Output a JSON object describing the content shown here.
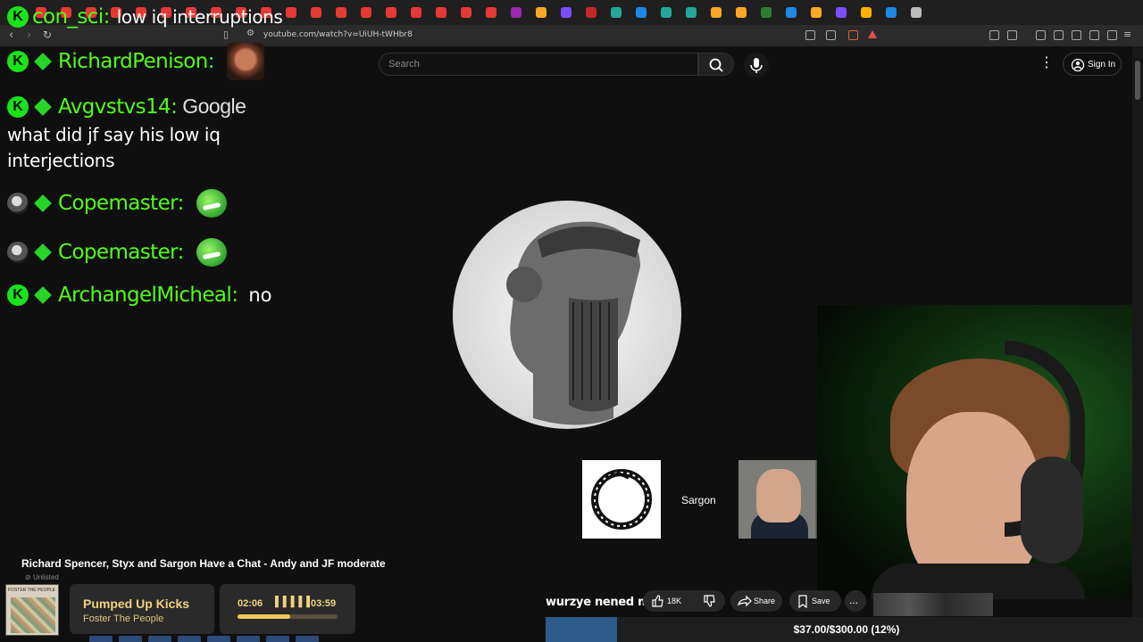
{
  "browser": {
    "url": "youtube.com/watch?v=UiUH-tWHbr8",
    "tab_colors": [
      "#e53935",
      "#e53935",
      "#e53935",
      "#e53935",
      "#e53935",
      "#e53935",
      "#e53935",
      "#e53935",
      "#e53935",
      "#e53935",
      "#e53935",
      "#e53935",
      "#e53935",
      "#e53935",
      "#e53935",
      "#e53935",
      "#e53935",
      "#e53935",
      "#e53935",
      "#9c27b0",
      "#f9a825",
      "#7c4dff",
      "#c62828",
      "#26a69a",
      "#1e88e5",
      "#26a69a",
      "#26a69a",
      "#f9a825",
      "#f9a825",
      "#2e7d32",
      "#1e88e5",
      "#f9a825",
      "#7c4dff",
      "#ffb300",
      "#1e88e5",
      "#bbbbbb"
    ]
  },
  "youtube": {
    "search_placeholder": "Search",
    "signin_label": "Sign In",
    "video_title": "Richard Spencer, Styx and Sargon Have a Chat - Andy and JF moderate",
    "visibility": "Unlisted",
    "like_count": "18K",
    "share_label": "Share",
    "save_label": "Save",
    "more_label": "...",
    "participant_label": "Sargon"
  },
  "chat": {
    "top": {
      "user": "con_sci:",
      "message": "low iq interruptions"
    },
    "messages": [
      {
        "user": "RichardPenison:",
        "badge": "kick",
        "message": "",
        "emote": "face-emote"
      },
      {
        "user": "Avgvstvs14:",
        "badge": "kick",
        "message": "Google",
        "continuation": "what did jf say his low iq interjections"
      },
      {
        "user": "Copemaster:",
        "badge": "avatar",
        "message": "",
        "emote": "green-grin-emote"
      },
      {
        "user": "Copemaster:",
        "badge": "avatar",
        "message": "",
        "emote": "green-grin-emote"
      },
      {
        "user": "ArchangelMicheal:",
        "badge": "kick",
        "message": "no"
      }
    ]
  },
  "donation": {
    "text": "wurzye nened money",
    "goal_text": "$37.00/$300.00 (12%)",
    "goal_fraction": 0.12
  },
  "now_playing": {
    "album_caption": "FOSTER THE PEOPLE",
    "title": "Pumped Up Kicks",
    "artist": "Foster The People",
    "current_time": "02:06",
    "eq_glyph": "▌▌▌▌▌",
    "total_time": "03:59",
    "progress_fraction": 0.53
  },
  "colors": {
    "kick_green": "#53fc18",
    "song_gold": "#f1d27e",
    "goal_fill": "#2c5b8a"
  }
}
